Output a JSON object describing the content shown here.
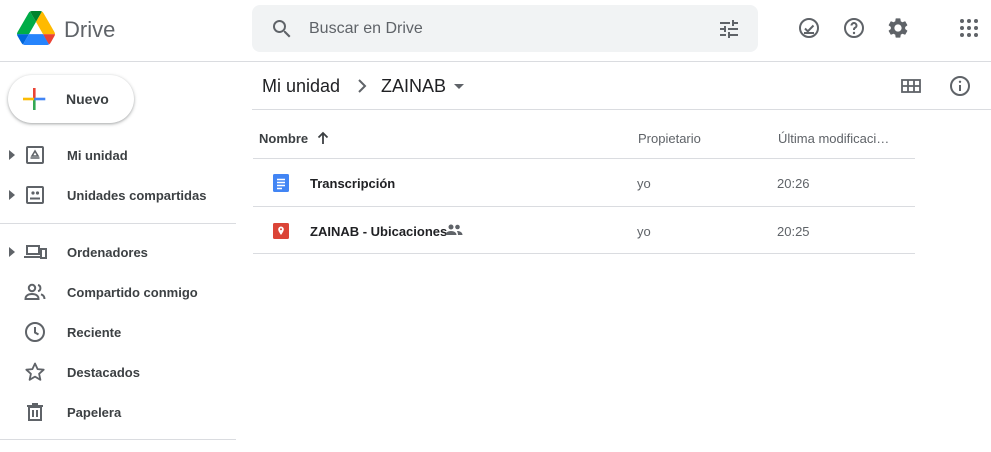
{
  "header": {
    "app_title": "Drive",
    "search_placeholder": "Buscar en Drive",
    "icons": [
      "search-icon",
      "tune-icon",
      "offline-check-icon",
      "help-icon",
      "settings-icon",
      "apps-grid-icon"
    ]
  },
  "sidebar": {
    "new_label": "Nuevo",
    "items": [
      {
        "label": "Mi unidad",
        "icon": "my-drive-icon",
        "expandable": true
      },
      {
        "label": "Unidades compartidas",
        "icon": "shared-drives-icon",
        "expandable": true
      },
      {
        "label": "Ordenadores",
        "icon": "computers-icon",
        "expandable": true
      },
      {
        "label": "Compartido conmigo",
        "icon": "shared-with-me-icon",
        "expandable": false
      },
      {
        "label": "Reciente",
        "icon": "clock-icon",
        "expandable": false
      },
      {
        "label": "Destacados",
        "icon": "star-icon",
        "expandable": false
      },
      {
        "label": "Papelera",
        "icon": "trash-icon",
        "expandable": false
      }
    ]
  },
  "breadcrumb": {
    "root": "Mi unidad",
    "current": "ZAINAB"
  },
  "table": {
    "columns": {
      "name": "Nombre",
      "owner": "Propietario",
      "modified": "Última modificaci…"
    },
    "rows": [
      {
        "name": "Transcripción",
        "type": "docs",
        "owner": "yo",
        "modified": "20:26",
        "shared": false
      },
      {
        "name": "ZAINAB - Ubicaciones",
        "type": "maps",
        "owner": "yo",
        "modified": "20:25",
        "shared": true
      }
    ]
  },
  "colors": {
    "docs_blue": "#4285f4",
    "maps_red": "#db4437",
    "icon_gray": "#5f6368",
    "divider": "#dadce0"
  }
}
